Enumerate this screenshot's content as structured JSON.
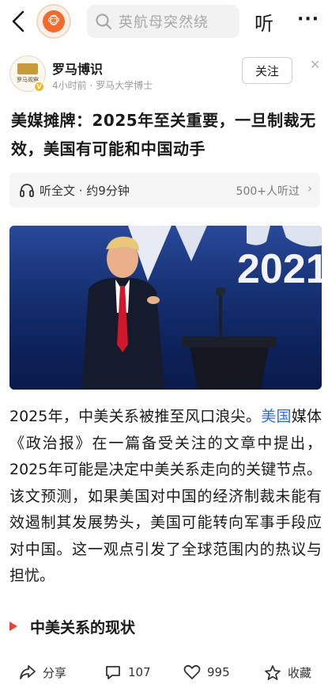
{
  "header": {
    "search_placeholder": "英航母突然绕",
    "listen_label": "听",
    "more_label": "···",
    "logo_glyph": "🐵"
  },
  "author": {
    "name": "罗马博识",
    "meta": "4小时前 · 罗马大学博士",
    "avatar_text": "罗马观察",
    "follow_label": "关注"
  },
  "article": {
    "title": "美媒摊牌：2025年至关重要，一旦制裁无效，美国有可能和中国动手",
    "listen_full": "听全文 · 约9分钟",
    "listen_count": "500+人听过",
    "image_text": "2021",
    "body_before": "2025年，中美关系被推至风口浪尖。",
    "body_link": "美国",
    "body_after": "媒体《政治报》在一篇备受关注的文章中提出，2025年可能是决定中美关系走向的关键节点。该文预测，如果美国对中国的经济制裁未能有效遏制其发展势头，美国可能转向军事手段应对中国。这一观点引发了全球范围内的热议与担忧。",
    "section_title": "中美关系的现状"
  },
  "bottom_bar": {
    "share_label": "分享",
    "comment_count": "107",
    "like_count": "995",
    "favorite_label": "收藏"
  },
  "colors": {
    "accent_red": "#e0453a",
    "link_blue": "#2f6ed8",
    "photo_bg": "#0d2563",
    "logo_orange": "#f26a2e"
  }
}
